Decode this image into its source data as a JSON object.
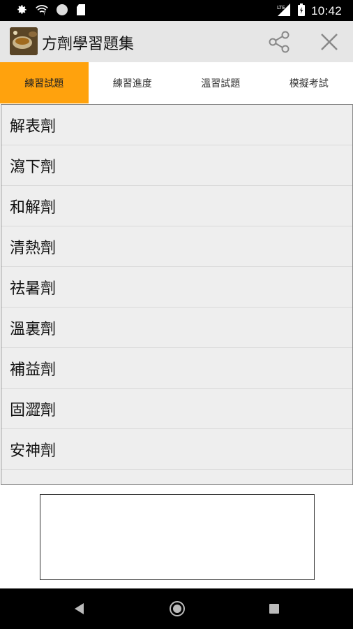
{
  "status_bar": {
    "time": "10:42",
    "network_label": "LTE",
    "icons": [
      "gear-icon",
      "wifi-unknown-icon",
      "circle-icon",
      "sd-card-icon",
      "signal-icon",
      "battery-icon"
    ]
  },
  "app_bar": {
    "title": "方劑學習題集",
    "icon": "app-logo-icon",
    "actions": [
      "share-icon",
      "close-icon"
    ]
  },
  "tabs": [
    {
      "label": "練習試題",
      "active": true
    },
    {
      "label": "練習進度",
      "active": false
    },
    {
      "label": "溫習試題",
      "active": false
    },
    {
      "label": "模擬考試",
      "active": false
    }
  ],
  "list": {
    "items": [
      "解表劑",
      "瀉下劑",
      "和解劑",
      "清熱劑",
      "祛暑劑",
      "溫裏劑",
      "補益劑",
      "固澀劑",
      "安神劑"
    ]
  },
  "colors": {
    "tab_active": "#ffa20d",
    "app_bar_bg": "#e6e6e6",
    "list_bg": "#eeeeee"
  },
  "nav_bar": {
    "icons": [
      "back-icon",
      "home-icon",
      "recents-icon"
    ]
  }
}
